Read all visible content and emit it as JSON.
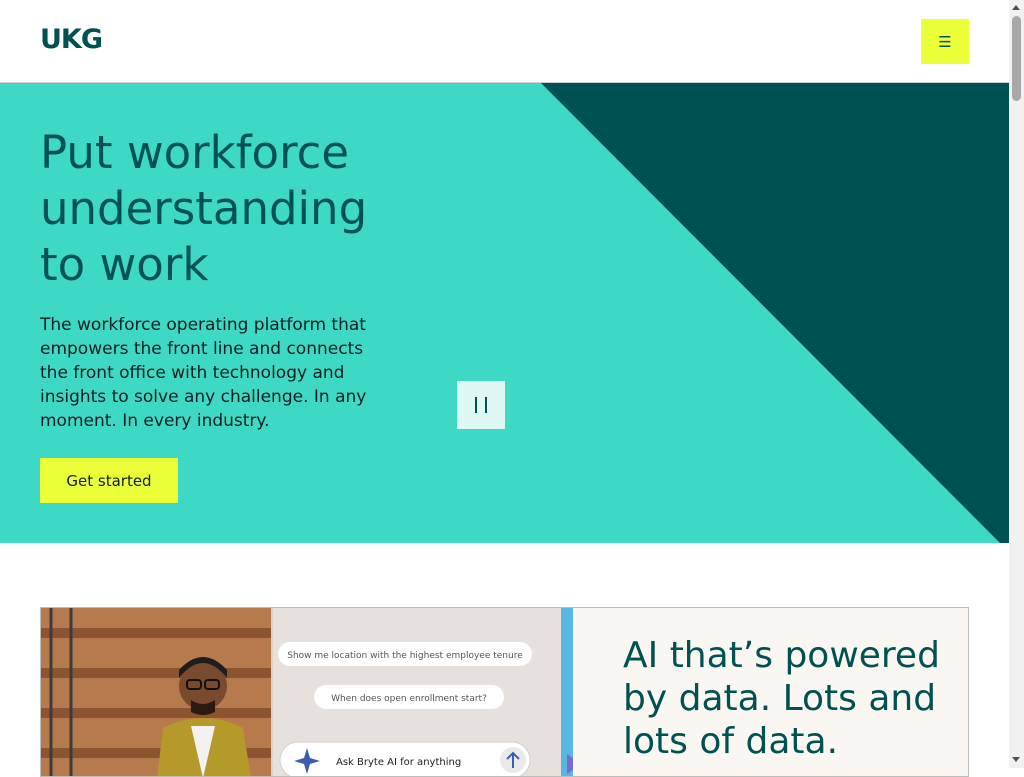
{
  "header": {
    "logo_text": "UKG",
    "menu_icon": "hamburger-icon",
    "menu_glyph": "☰"
  },
  "hero": {
    "title": "Put workforce understanding to work",
    "body": "The workforce operating platform that empowers the front line and connects the front office with technology and insights to solve any challenge. In any moment. In every industry.",
    "cta_label": "Get started",
    "pause_icon": "pause-icon"
  },
  "feature_card": {
    "title": "AI that’s powered by data. Lots and lots of data.",
    "image": {
      "chat_bubbles": [
        "Show me location with the highest employee tenure",
        "When does open enrollment start?"
      ],
      "prompt_placeholder": "Ask Bryte AI for anything",
      "sparkle_icon": "sparkle-icon",
      "send_icon": "arrow-up-icon"
    }
  },
  "colors": {
    "brand_teal": "#005151",
    "hero_mint": "#3dd9c5",
    "accent_yellow": "#ebff38",
    "card_bg": "#faf7f2"
  }
}
